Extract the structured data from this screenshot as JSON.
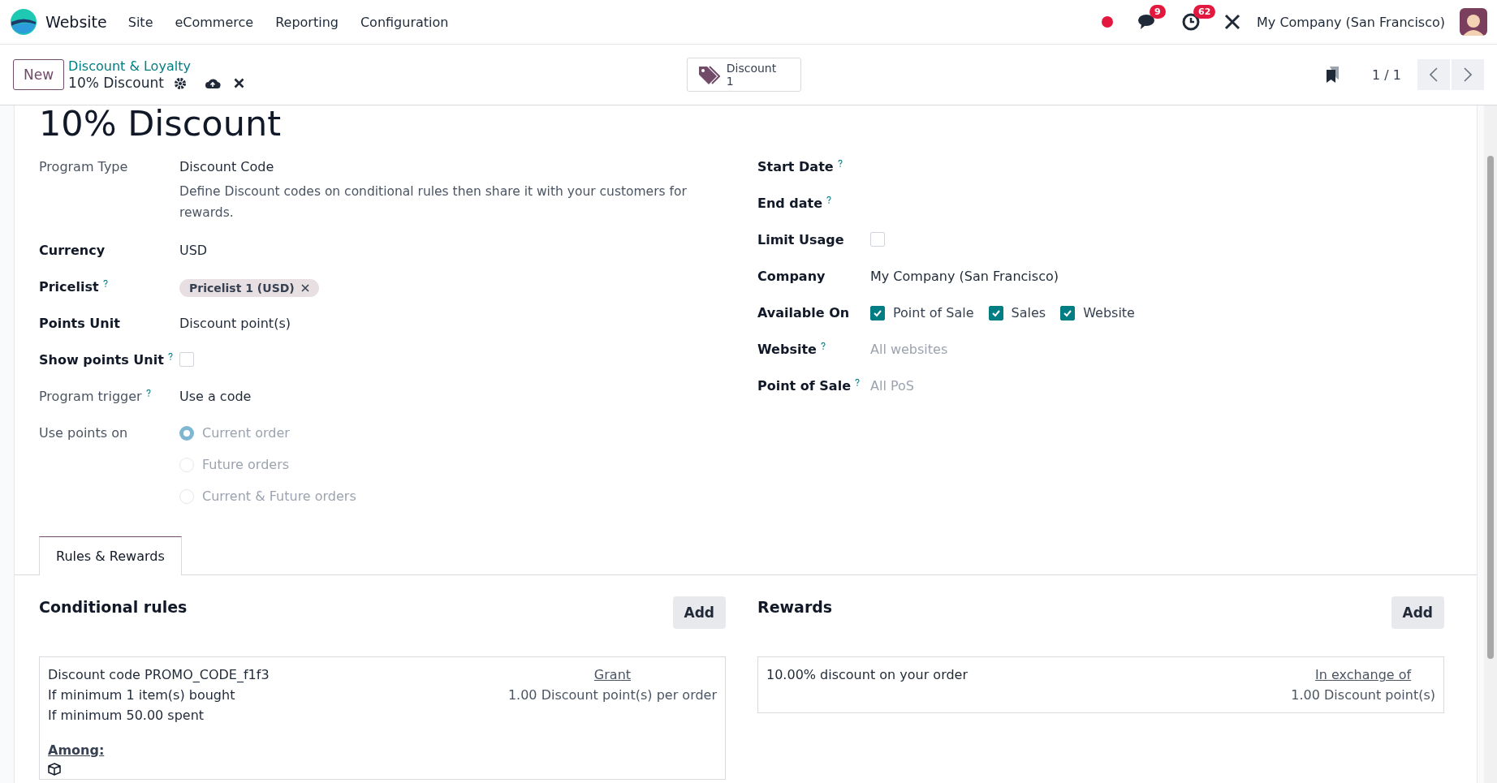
{
  "navbar": {
    "app": "Website",
    "menus": [
      "Site",
      "eCommerce",
      "Reporting",
      "Configuration"
    ],
    "messages_badge": "9",
    "activities_badge": "62",
    "company": "My Company (San Francisco)"
  },
  "control_panel": {
    "new_button": "New",
    "breadcrumb": "Discount & Loyalty",
    "record": "10% Discount",
    "smart_button": {
      "label": "Discount",
      "count": "1"
    },
    "pager": "1 / 1"
  },
  "title": "10% Discount",
  "left_fields": [
    {
      "kind": "text",
      "label": "Program Type",
      "readonly": true,
      "help": false,
      "value": "Discount Code",
      "note": "Define Discount codes on conditional rules then share it with your customers for rewards."
    },
    {
      "kind": "text",
      "label": "Currency",
      "readonly": false,
      "help": false,
      "value": "USD"
    },
    {
      "kind": "tags",
      "label": "Pricelist",
      "readonly": false,
      "help": true,
      "tags": [
        "Pricelist 1 (USD)"
      ]
    },
    {
      "kind": "text",
      "label": "Points Unit",
      "readonly": false,
      "help": false,
      "value": "Discount point(s)"
    },
    {
      "kind": "checkbox",
      "label": "Show points Unit",
      "readonly": false,
      "help": true,
      "checked": false
    },
    {
      "kind": "text",
      "label": "Program trigger",
      "readonly": true,
      "help": true,
      "value": "Use a code"
    },
    {
      "kind": "radio",
      "label": "Use points on",
      "readonly": true,
      "help": false,
      "options": [
        {
          "label": "Current order",
          "selected": true
        },
        {
          "label": "Future orders",
          "selected": false
        },
        {
          "label": "Current & Future orders",
          "selected": false
        }
      ]
    }
  ],
  "right_fields": [
    {
      "kind": "empty",
      "label": "Start Date",
      "readonly": false,
      "help": true
    },
    {
      "kind": "empty",
      "label": "End date",
      "readonly": false,
      "help": true
    },
    {
      "kind": "checkbox",
      "label": "Limit Usage",
      "readonly": false,
      "help": false,
      "checked": false
    },
    {
      "kind": "text",
      "label": "Company",
      "readonly": false,
      "help": false,
      "value": "My Company (San Francisco)"
    },
    {
      "kind": "checks",
      "label": "Available On",
      "readonly": false,
      "help": false,
      "options": [
        {
          "label": "Point of Sale",
          "checked": true
        },
        {
          "label": "Sales",
          "checked": true
        },
        {
          "label": "Website",
          "checked": true
        }
      ]
    },
    {
      "kind": "placeholder",
      "label": "Website",
      "readonly": false,
      "help": true,
      "placeholder": "All websites"
    },
    {
      "kind": "placeholder",
      "label": "Point of Sale",
      "readonly": false,
      "help": true,
      "placeholder": "All PoS"
    }
  ],
  "tabs": [
    {
      "label": "Rules & Rewards",
      "selected": true
    }
  ],
  "rules": {
    "heading": "Conditional rules",
    "add": "Add",
    "lines": [
      "Discount code PROMO_CODE_f1f3",
      "If minimum 1 item(s) bought",
      "If minimum 50.00 spent"
    ],
    "right_heading": "Grant",
    "right_text": "1.00 Discount point(s) per order",
    "among": "Among:"
  },
  "rewards": {
    "heading": "Rewards",
    "add": "Add",
    "lines": [
      "10.00% discount on your order"
    ],
    "right_heading": "In exchange of",
    "right_text": "1.00 Discount point(s)"
  }
}
